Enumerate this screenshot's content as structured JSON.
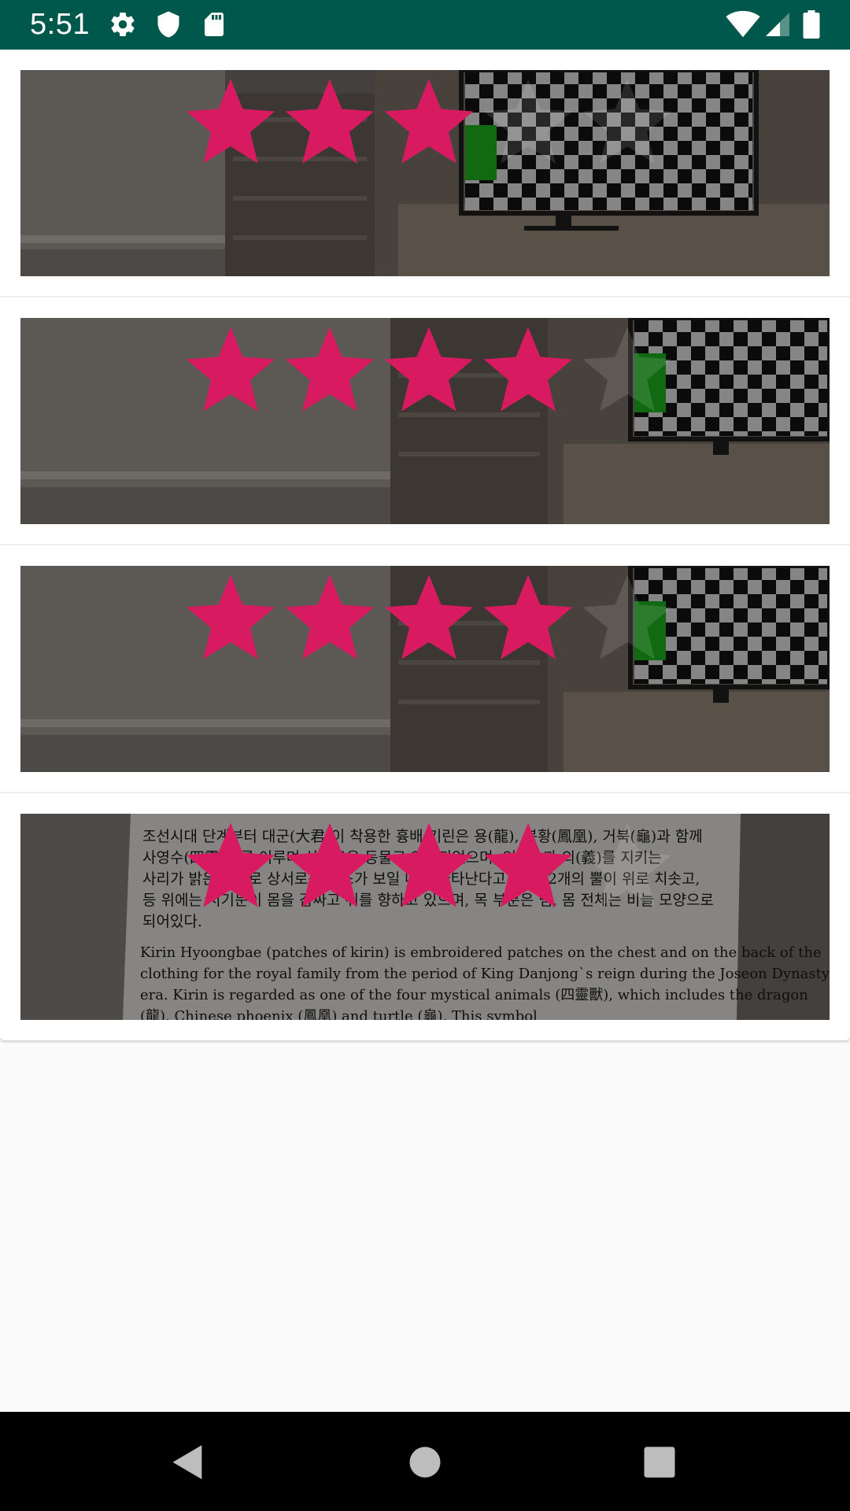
{
  "status_bar": {
    "time": "5:51",
    "left_icons": [
      "settings-icon",
      "shield-icon",
      "sd-card-icon"
    ],
    "right_icons": [
      "wifi-icon",
      "cell-signal-icon",
      "battery-icon"
    ],
    "background": "#00574b"
  },
  "list": {
    "items": [
      {
        "image": "room-with-checkerboard-tv",
        "rating": 3,
        "max_rating": 5
      },
      {
        "image": "room-with-checkerboard-tv",
        "rating": 4,
        "max_rating": 5
      },
      {
        "image": "room-with-checkerboard-tv",
        "rating": 4,
        "max_rating": 5
      },
      {
        "image": "document-page",
        "rating": 4,
        "max_rating": 5,
        "document_lines": [
          "조선시대 단계부터 대군(大君)이 착용한 흉배 기린은 용(龍), 봉황(鳳凰), 거북(龜)과 함께",
          "사영수(四靈獸)를 이루며 상서로운 동물로 인식되었으며, 인(仁)과 의(義)를 지키는",
          "사리가 밝은 것으로 상서로운 징조가 보일 때에 나타난다고 한다. 2개의 뿔이 위로 치솟고,",
          "등 위에는 서기문이 몸을 감싸고 위를 향하고 있으며, 목 부분은 뱀, 몸 전체는 비늘 모양으로",
          "되어있다.",
          "Kirin Hyoongbae (patches of kirin) is embroidered patches on the chest and on the back of the",
          "clothing for the royal family from the period of King Danjong`s reign during the Joseon Dynasty",
          "era. Kirin is regarded as one of the four mystical animals (四靈獸), which includes the dragon",
          "(龍), Chinese phoenix (鳳凰) and turtle (龜). This symbol"
        ]
      }
    ]
  },
  "colors": {
    "star_filled": "#d81b60",
    "star_empty": "rgba(255,255,255,0.12)",
    "image_overlay": "rgba(0,0,0,0.45)"
  },
  "nav_bar": {
    "buttons": [
      "back-icon",
      "home-icon",
      "recents-icon"
    ]
  }
}
